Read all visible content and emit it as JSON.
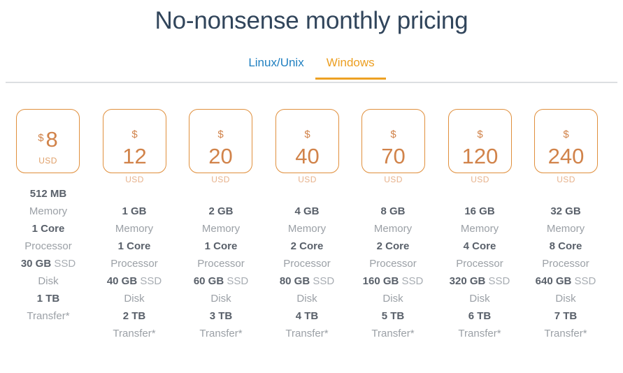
{
  "header": {
    "title": "No-nonsense monthly pricing"
  },
  "tabs": {
    "items": [
      {
        "label": "Linux/Unix",
        "active": false
      },
      {
        "label": "Windows",
        "active": true
      }
    ],
    "accent_color": "#eda123",
    "link_color": "#1f7fc0",
    "rule_color": "#dcdfe2"
  },
  "plans": [
    {
      "currency_symbol": "$",
      "price": "8",
      "currency_code": "USD",
      "layout": "inline",
      "memory_value": "512 MB",
      "memory_label": "Memory",
      "processor_value": "1 Core",
      "processor_label": "Processor",
      "disk_value": "30 GB",
      "disk_suffix": "SSD",
      "disk_label": "Disk",
      "transfer_value": "1 TB",
      "transfer_label": "Transfer*"
    },
    {
      "currency_symbol": "$",
      "price": "12",
      "currency_code": "USD",
      "layout": "stacked",
      "memory_value": "1 GB",
      "memory_label": "Memory",
      "processor_value": "1 Core",
      "processor_label": "Processor",
      "disk_value": "40 GB",
      "disk_suffix": "SSD",
      "disk_label": "Disk",
      "transfer_value": "2 TB",
      "transfer_label": "Transfer*"
    },
    {
      "currency_symbol": "$",
      "price": "20",
      "currency_code": "USD",
      "layout": "stacked",
      "memory_value": "2 GB",
      "memory_label": "Memory",
      "processor_value": "1 Core",
      "processor_label": "Processor",
      "disk_value": "60 GB",
      "disk_suffix": "SSD",
      "disk_label": "Disk",
      "transfer_value": "3 TB",
      "transfer_label": "Transfer*"
    },
    {
      "currency_symbol": "$",
      "price": "40",
      "currency_code": "USD",
      "layout": "stacked",
      "memory_value": "4 GB",
      "memory_label": "Memory",
      "processor_value": "2 Core",
      "processor_label": "Processor",
      "disk_value": "80 GB",
      "disk_suffix": "SSD",
      "disk_label": "Disk",
      "transfer_value": "4 TB",
      "transfer_label": "Transfer*"
    },
    {
      "currency_symbol": "$",
      "price": "70",
      "currency_code": "USD",
      "layout": "stacked",
      "memory_value": "8 GB",
      "memory_label": "Memory",
      "processor_value": "2 Core",
      "processor_label": "Processor",
      "disk_value": "160 GB",
      "disk_suffix": "SSD",
      "disk_label": "Disk",
      "transfer_value": "5 TB",
      "transfer_label": "Transfer*"
    },
    {
      "currency_symbol": "$",
      "price": "120",
      "currency_code": "USD",
      "layout": "stacked",
      "memory_value": "16 GB",
      "memory_label": "Memory",
      "processor_value": "4 Core",
      "processor_label": "Processor",
      "disk_value": "320 GB",
      "disk_suffix": "SSD",
      "disk_label": "Disk",
      "transfer_value": "6 TB",
      "transfer_label": "Transfer*"
    },
    {
      "currency_symbol": "$",
      "price": "240",
      "currency_code": "USD",
      "layout": "stacked",
      "memory_value": "32 GB",
      "memory_label": "Memory",
      "processor_value": "8 Core",
      "processor_label": "Processor",
      "disk_value": "640 GB",
      "disk_suffix": "SSD",
      "disk_label": "Disk",
      "transfer_value": "7 TB",
      "transfer_label": "Transfer*"
    }
  ],
  "theme": {
    "card_border": "#e08f3c",
    "price_text": "#d1834a",
    "value_text": "#59606a",
    "label_text": "#9ba0a6",
    "title_text": "#31455b"
  }
}
